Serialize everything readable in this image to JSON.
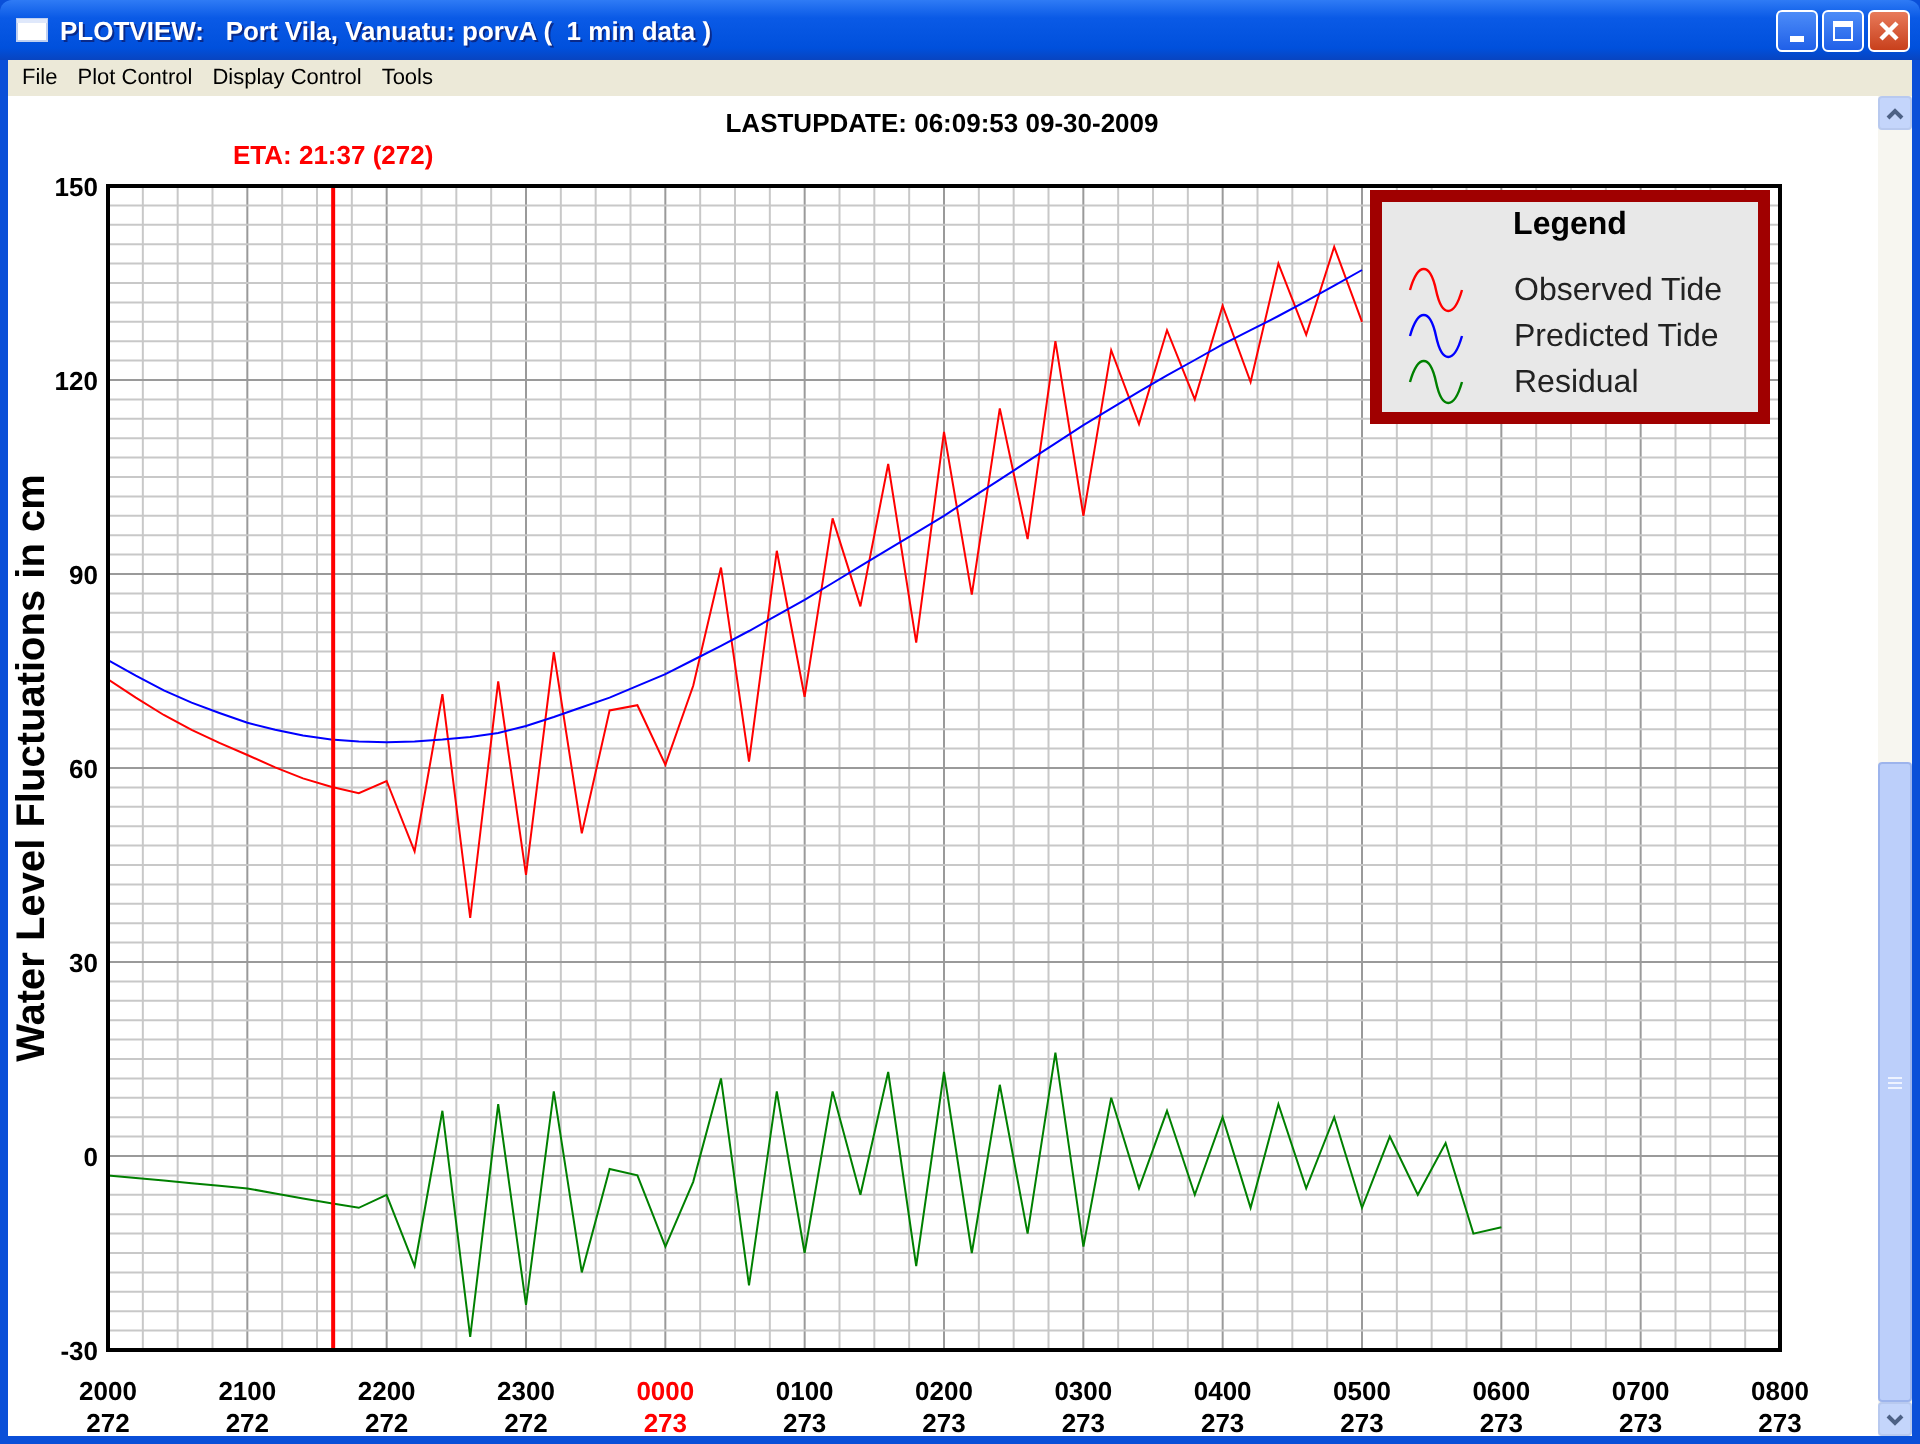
{
  "window": {
    "title": "PLOTVIEW:   Port Vila, Vanuatu: porvA (  1 min data )"
  },
  "menu": [
    "File",
    "Plot Control",
    "Display Control",
    "Tools"
  ],
  "plot": {
    "last_update": "LASTUPDATE: 06:09:53  09-30-2009",
    "eta_label": "ETA: 21:37 (272)",
    "legend_title": "Legend",
    "x_tick_days": [
      {
        "day": "272",
        "highlighted": false
      },
      {
        "day": "272",
        "highlighted": false
      },
      {
        "day": "272",
        "highlighted": false
      },
      {
        "day": "272",
        "highlighted": false
      },
      {
        "day": "273",
        "highlighted": true
      },
      {
        "day": "273",
        "highlighted": false
      },
      {
        "day": "273",
        "highlighted": false
      },
      {
        "day": "273",
        "highlighted": false
      },
      {
        "day": "273",
        "highlighted": false
      },
      {
        "day": "273",
        "highlighted": false
      },
      {
        "day": "273",
        "highlighted": false
      },
      {
        "day": "273",
        "highlighted": false
      },
      {
        "day": "273",
        "highlighted": false
      }
    ],
    "chart_data": {
      "type": "line",
      "ylabel": "Water Level Fluctuations in cm",
      "ylim": [
        -30,
        150
      ],
      "yticks": [
        {
          "value": -30,
          "label": "-30"
        },
        {
          "value": 0,
          "label": "0"
        },
        {
          "value": 30,
          "label": "30"
        },
        {
          "value": 60,
          "label": "60"
        },
        {
          "value": 90,
          "label": "90"
        },
        {
          "value": 120,
          "label": "120"
        },
        {
          "value": 150,
          "label": "150"
        }
      ],
      "categories": [
        "2000",
        null,
        null,
        null,
        null,
        "2100",
        null,
        null,
        null,
        null,
        "2200",
        null,
        null,
        null,
        null,
        "2300",
        null,
        null,
        null,
        null,
        "0000",
        null,
        null,
        null,
        null,
        "0100",
        null,
        null,
        null,
        null,
        "0200",
        null,
        null,
        null,
        null,
        "0300",
        null,
        null,
        null,
        null,
        "0400",
        null,
        null,
        null,
        null,
        "0500",
        null,
        null,
        null,
        null,
        "0600",
        null,
        null,
        null,
        null,
        "0700",
        null,
        null,
        null,
        null,
        "0800"
      ],
      "series": [
        {
          "name": "Observed Tide",
          "color": "#ff0000",
          "values": [
            73.7,
            70.9,
            68.2,
            65.9,
            63.9,
            62,
            60.1,
            58.4,
            57.1,
            56.1,
            58,
            47.1,
            71.4,
            36.8,
            73.4,
            43.5,
            77.9,
            49.9,
            68.9,
            69.7,
            60.5,
            72.7,
            91,
            61,
            93.6,
            71,
            98.6,
            85,
            107,
            79.4,
            112,
            86.8,
            115.6,
            95.4,
            126,
            99,
            124.6,
            113.2,
            127.7,
            117,
            131.5,
            119.7,
            138,
            127,
            140.6,
            129,
            null,
            null,
            null,
            null,
            null,
            null,
            null,
            null,
            null,
            null,
            null,
            null,
            null,
            null,
            null
          ]
        },
        {
          "name": "Predicted Tide",
          "color": "#0000ff",
          "values": [
            76.7,
            74.3,
            72,
            70.1,
            68.5,
            67,
            65.9,
            65,
            64.4,
            64.1,
            64,
            64.1,
            64.4,
            64.8,
            65.4,
            66.5,
            67.9,
            69.4,
            70.9,
            72.7,
            74.5,
            76.7,
            78.9,
            81.2,
            83.6,
            86,
            88.6,
            91.2,
            93.8,
            96.4,
            99,
            101.8,
            104.6,
            107.4,
            110.2,
            113,
            115.6,
            118.2,
            120.7,
            123.1,
            125.5,
            127.7,
            129.9,
            132.2,
            134.6,
            137,
            null,
            null,
            null,
            null,
            null,
            null,
            null,
            null,
            null,
            null,
            null,
            null,
            null,
            null,
            null
          ]
        },
        {
          "name": "Residual",
          "color": "#008000",
          "values": [
            -3,
            -3.4,
            -3.8,
            -4.2,
            -4.6,
            -5,
            -5.8,
            -6.6,
            -7.3,
            -8,
            -6,
            -17,
            7,
            -28,
            8,
            -23,
            10,
            -18,
            -2,
            -3,
            -14,
            -4,
            12,
            -20,
            10,
            -15,
            10,
            -6,
            13,
            -17,
            13,
            -15,
            11,
            -12,
            16,
            -14,
            9,
            -5,
            7,
            -6,
            6,
            -8,
            8,
            -5,
            6,
            -8,
            3,
            -6,
            2,
            -12,
            -11,
            null,
            null,
            null,
            null,
            null,
            null,
            null,
            null,
            null,
            null
          ]
        }
      ],
      "grid": true,
      "legend": true
    }
  }
}
